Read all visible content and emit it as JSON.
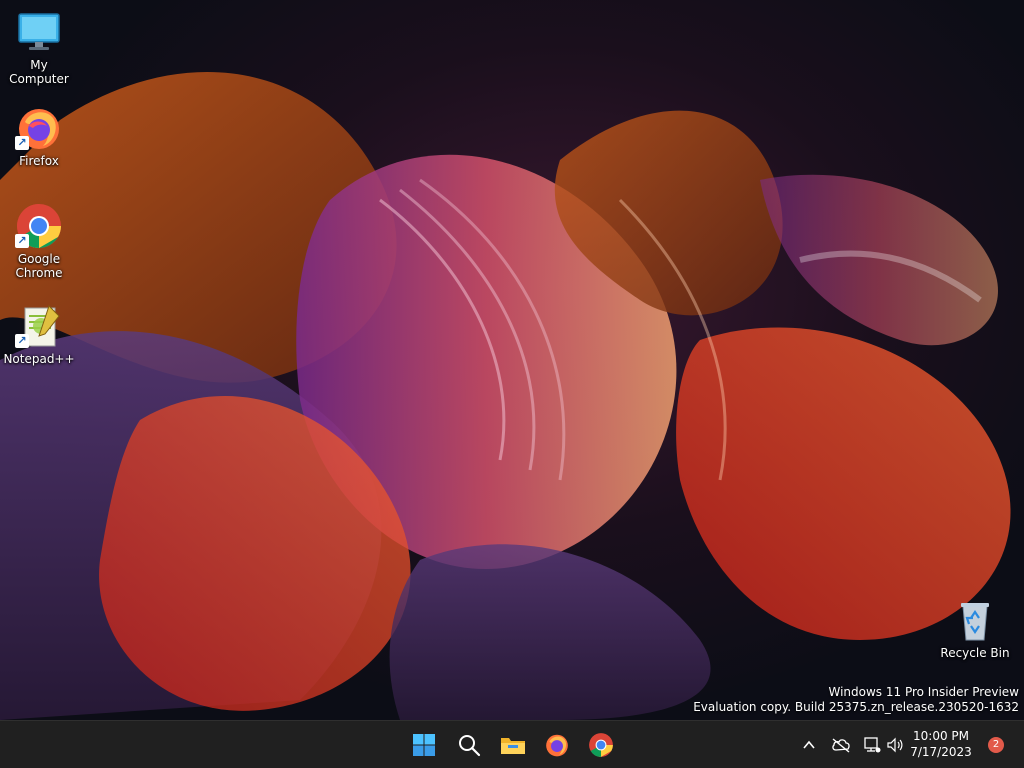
{
  "desktop": {
    "icons": [
      {
        "label": "My Computer",
        "icon": "monitor-icon"
      },
      {
        "label": "Firefox",
        "icon": "firefox-icon"
      },
      {
        "label": "Google Chrome",
        "icon": "chrome-icon"
      },
      {
        "label": "Notepad++",
        "icon": "notepad-plus-plus-icon"
      },
      {
        "label": "Recycle Bin",
        "icon": "recycle-bin-icon"
      }
    ],
    "watermark": {
      "line1": "Windows 11 Pro Insider Preview",
      "line2": "Evaluation copy. Build 25375.zn_release.230520-1632"
    }
  },
  "taskbar": {
    "apps": [
      {
        "name": "Start",
        "icon": "windows-start-icon"
      },
      {
        "name": "Search",
        "icon": "search-icon"
      },
      {
        "name": "File Explorer",
        "icon": "folder-icon"
      },
      {
        "name": "Firefox",
        "icon": "firefox-icon"
      },
      {
        "name": "Chrome",
        "icon": "chrome-icon"
      }
    ],
    "tray": {
      "icons": [
        "chevron-up-icon",
        "cloud-offline-icon",
        "network-icon",
        "volume-icon"
      ],
      "time": "10:00 PM",
      "date": "7/17/2023",
      "notification_count": "2"
    }
  },
  "colors": {
    "taskbar_bg": "#202020",
    "accent_blue": "#3a8ee6",
    "notification_badge": "#e25a4a"
  }
}
